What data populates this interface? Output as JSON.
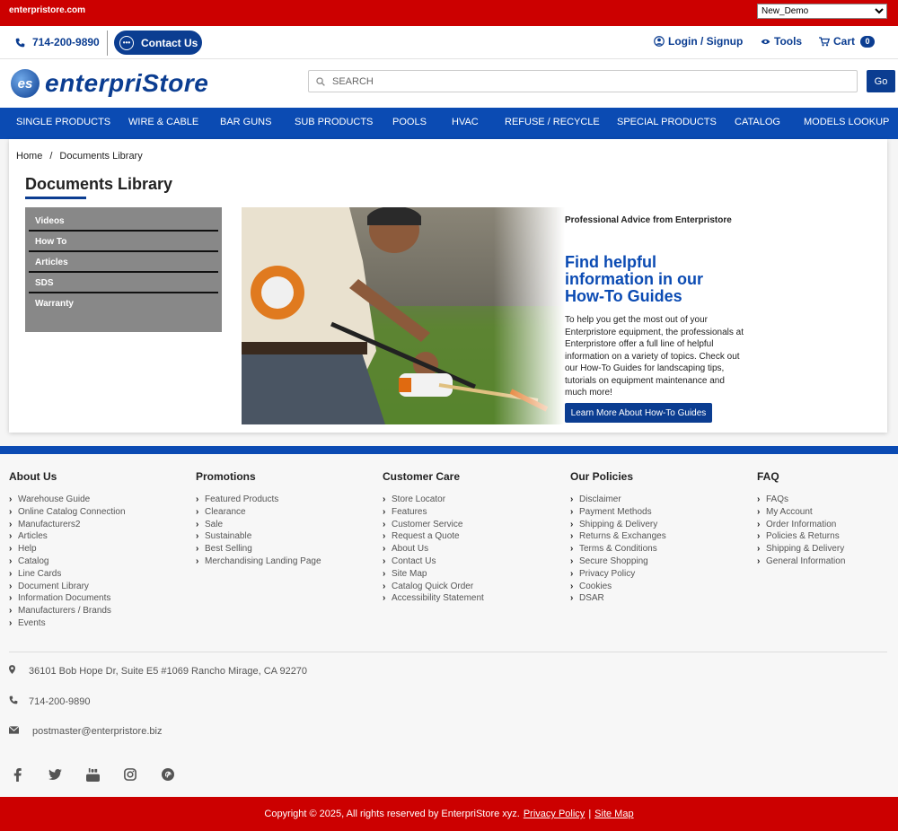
{
  "topbar": {
    "site": "enterpristore.com",
    "store_select": "New_Demo"
  },
  "header": {
    "phone": "714-200-9890",
    "contact_label": "Contact Us",
    "login_label": "Login / Signup",
    "tools_label": "Tools",
    "cart_label": "Cart",
    "cart_count": "0"
  },
  "brand": {
    "logo_mark": "es",
    "logo_text": "enterpriStore"
  },
  "search": {
    "placeholder": "SEARCH",
    "go_label": "Go"
  },
  "nav": {
    "items": [
      "SINGLE PRODUCTS",
      "WIRE & CABLE",
      "BAR GUNS",
      "SUB PRODUCTS",
      "POOLS",
      "HVAC",
      "REFUSE / RECYCLE",
      "SPECIAL PRODUCTS",
      "CATALOG",
      "MODELS LOOKUP"
    ]
  },
  "breadcrumb": {
    "home": "Home",
    "sep": "/",
    "current": "Documents Library"
  },
  "page": {
    "title": "Documents Library"
  },
  "sidemenu": {
    "items": [
      "Videos",
      "How To",
      "Articles",
      "SDS",
      "Warranty"
    ]
  },
  "promo": {
    "subtitle": "Professional Advice from Enterpristore",
    "headline": "Find helpful information in our How-To Guides",
    "body": "To help you get the most out of your Enterpristore equipment, the professionals at Enterpristore offer a full line of helpful information on a variety of topics. Check out our How-To Guides for landscaping tips, tutorials on equipment maintenance and much more!",
    "button": "Learn More About How-To Guides"
  },
  "footer": {
    "about": {
      "title": "About Us",
      "links": [
        "Warehouse Guide",
        "Online Catalog Connection",
        "Manufacturers2",
        "Articles",
        "Help",
        "Catalog",
        "Line Cards",
        "Document Library",
        "Information Documents",
        "Manufacturers / Brands",
        "Events"
      ]
    },
    "promotions": {
      "title": "Promotions",
      "links": [
        "Featured Products",
        "Clearance",
        "Sale",
        "Sustainable",
        "Best Selling",
        "Merchandising Landing Page"
      ]
    },
    "care": {
      "title": "Customer Care",
      "links": [
        "Store Locator",
        "Features",
        "Customer Service",
        "Request a Quote",
        "About Us",
        "Contact Us",
        "Site Map",
        "Catalog Quick Order",
        "Accessibility Statement"
      ]
    },
    "policies": {
      "title": "Our Policies",
      "links": [
        "Disclaimer",
        "Payment Methods",
        "Shipping & Delivery",
        "Returns & Exchanges",
        "Terms & Conditions",
        "Secure Shopping",
        "Privacy Policy",
        "Cookies",
        "DSAR"
      ]
    },
    "faq": {
      "title": "FAQ",
      "links": [
        "FAQs",
        "My Account",
        "Order Information",
        "Policies & Returns",
        "Shipping & Delivery",
        "General Information"
      ]
    },
    "address": "36101 Bob Hope Dr, Suite E5 #1069 Rancho Mirage, CA 92270",
    "phone": "714-200-9890",
    "email": "postmaster@enterpristore.biz",
    "copyright": "Copyright © 2025, All rights reserved by EnterpriStore xyz.",
    "privacy_link": "Privacy Policy",
    "divider": "|",
    "sitemap_link": "Site Map"
  },
  "colors": {
    "brand_red": "#cc0000",
    "brand_blue": "#0b3d91",
    "nav_blue": "#0b4bb3"
  }
}
